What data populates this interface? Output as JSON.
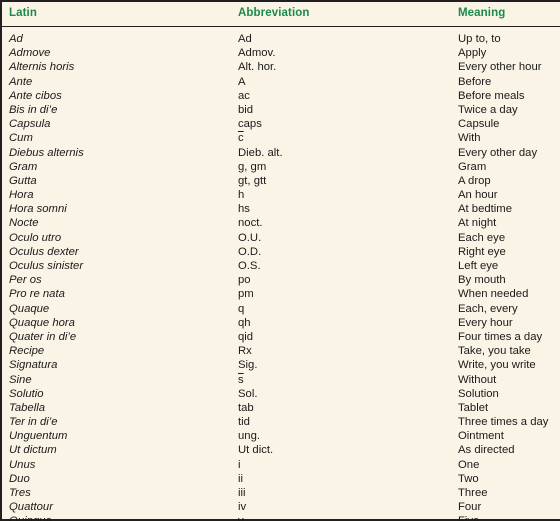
{
  "table": {
    "colors": {
      "background": "#FAF4E6",
      "header_text": "#1B8A4B",
      "body_text": "#1a1a1a",
      "rule": "#231f20"
    },
    "headers": {
      "latin": "Latin",
      "abbreviation": "Abbreviation",
      "meaning": "Meaning"
    },
    "rows": [
      {
        "latin": "Ad",
        "abbreviation": "Ad",
        "meaning": "Up to, to"
      },
      {
        "latin": "Admove",
        "abbreviation": "Admov.",
        "meaning": "Apply"
      },
      {
        "latin": "Alternis horis",
        "abbreviation": "Alt. hor.",
        "meaning": "Every other hour"
      },
      {
        "latin": "Ante",
        "abbreviation": "A",
        "meaning": "Before"
      },
      {
        "latin": "Ante cibos",
        "abbreviation": "ac",
        "meaning": "Before meals"
      },
      {
        "latin": "Bis in di’e",
        "abbreviation": "bid",
        "meaning": "Twice a day"
      },
      {
        "latin": "Capsula",
        "abbreviation": "caps",
        "meaning": "Capsule"
      },
      {
        "latin": "Cum",
        "abbreviation": "c",
        "abbreviation_overline": true,
        "meaning": "With"
      },
      {
        "latin": "Diebus alternis",
        "abbreviation": "Dieb. alt.",
        "meaning": "Every other day"
      },
      {
        "latin": "Gram",
        "abbreviation": "g, gm",
        "meaning": "Gram"
      },
      {
        "latin": "Gutta",
        "abbreviation": "gt, gtt",
        "meaning": "A drop"
      },
      {
        "latin": "Hora",
        "abbreviation": "h",
        "meaning": "An hour"
      },
      {
        "latin": "Hora somni",
        "abbreviation": "hs",
        "meaning": "At bedtime"
      },
      {
        "latin": "Nocte",
        "abbreviation": "noct.",
        "meaning": "At night"
      },
      {
        "latin": "Oculo utro",
        "abbreviation": "O.U.",
        "meaning": "Each eye"
      },
      {
        "latin": "Oculus dexter",
        "abbreviation": "O.D.",
        "meaning": "Right eye"
      },
      {
        "latin": "Oculus sinister",
        "abbreviation": "O.S.",
        "meaning": "Left eye"
      },
      {
        "latin": "Per os",
        "abbreviation": "po",
        "meaning": "By mouth"
      },
      {
        "latin": "Pro re nata",
        "abbreviation": "pm",
        "meaning": "When needed"
      },
      {
        "latin": "Quaque",
        "abbreviation": "q",
        "meaning": "Each, every"
      },
      {
        "latin": "Quaque hora",
        "abbreviation": "qh",
        "meaning": "Every hour"
      },
      {
        "latin": "Quater in di’e",
        "abbreviation": "qid",
        "meaning": "Four times a day"
      },
      {
        "latin": "Recipe",
        "abbreviation": "Rx",
        "meaning": "Take, you take"
      },
      {
        "latin": "Signatura",
        "abbreviation": "Sig.",
        "meaning": "Write, you write"
      },
      {
        "latin": "Sine",
        "abbreviation": "s",
        "abbreviation_overline": true,
        "meaning": "Without"
      },
      {
        "latin": "Solutio",
        "abbreviation": "Sol.",
        "meaning": "Solution"
      },
      {
        "latin": "Tabella",
        "abbreviation": "tab",
        "meaning": "Tablet"
      },
      {
        "latin": "Ter in di’e",
        "abbreviation": "tid",
        "meaning": "Three times a day"
      },
      {
        "latin": "Unguentum",
        "abbreviation": "ung.",
        "meaning": "Ointment"
      },
      {
        "latin": "Ut dictum",
        "abbreviation": "Ut dict.",
        "meaning": "As directed"
      },
      {
        "latin": "Unus",
        "abbreviation": "i",
        "meaning": "One"
      },
      {
        "latin": "Duo",
        "abbreviation": "ii",
        "meaning": "Two"
      },
      {
        "latin": "Tres",
        "abbreviation": "iii",
        "meaning": "Three"
      },
      {
        "latin": "Quattour",
        "abbreviation": "iv",
        "meaning": "Four"
      },
      {
        "latin": "Quinque",
        "abbreviation": "v",
        "meaning": "Five"
      }
    ]
  }
}
